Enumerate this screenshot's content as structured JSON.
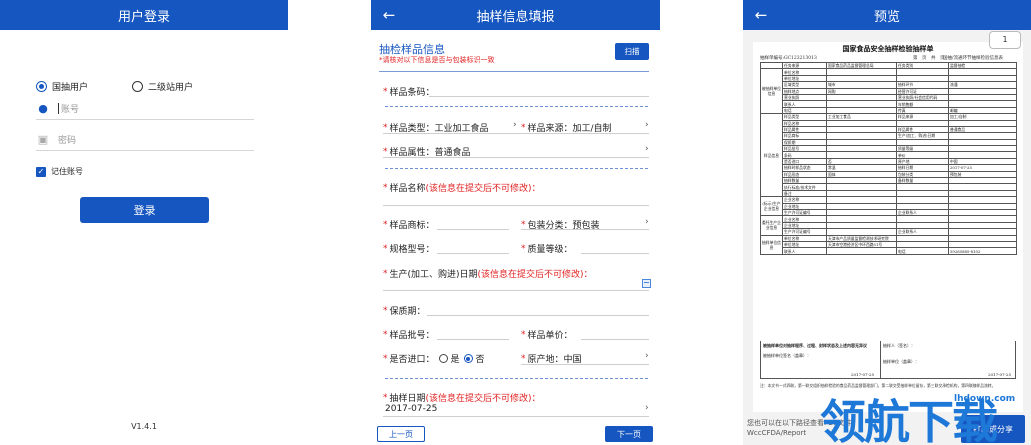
{
  "login": {
    "title": "用户登录",
    "radio_national": "国抽用户",
    "radio_secondary": "二级站用户",
    "account_placeholder": "账号",
    "password_placeholder": "密码",
    "remember": "记住账号",
    "login_button": "登录",
    "version": "V1.4.1"
  },
  "form": {
    "back_glyph": "←",
    "title": "抽样信息填报",
    "section_title": "抽检样品信息",
    "section_note": "*请核对以下信息是否与包装标识一致",
    "scan_button": "扫描",
    "fields": {
      "barcode": "样品条码：",
      "type_label": "样品类型：",
      "type_value": "工业加工食品",
      "source_label": "样品来源：",
      "source_value": "加工/自制",
      "attr_label": "样品属性：",
      "attr_value": "普通食品",
      "name_label": "样品名称",
      "name_note": "(该信息在提交后不可修改)：",
      "brand_label": "样品商标：",
      "pack_label": "包装分类：",
      "pack_value": "预包装",
      "spec_label": "规格型号：",
      "grade_label": "质量等级：",
      "date_label": "生产(加工、购进)日期",
      "date_note": "(该信息在提交后不可修改)：",
      "shelf_label": "保质期：",
      "batch_label": "样品批号：",
      "price_label": "样品单价：",
      "import_label": "是否进口：",
      "import_yes": "是",
      "import_no": "否",
      "origin_label": "原产地：",
      "origin_value": "中国",
      "sample_date_label": "抽样日期",
      "sample_date_note": "(该信息在提交后不可修改)：",
      "sample_date_value": "2017-07-25"
    },
    "prev_button": "上一页",
    "next_button": "下一页"
  },
  "preview": {
    "back_glyph": "←",
    "title": "预览",
    "page_badge": "1",
    "doc_title": "国家食品安全抽样检验抽样单",
    "doc_no": "抽样单编号:GC123213013",
    "doc_page": "第　页　共　页",
    "doc_org": "国抽/流通环节抽样检验信息表",
    "rows": [
      [
        "任务来源",
        "国家食品药品监督管理总局",
        "任务类别",
        "监督抽检"
      ],
      [
        "单位名称",
        "",
        "",
        ""
      ],
      [
        "单位地址",
        "",
        "",
        ""
      ],
      [
        "区域类型",
        "城市",
        "抽样环节",
        "流通"
      ],
      [
        "抽样地点",
        "网购",
        "经营许可证",
        ""
      ],
      [
        "营业执照",
        "",
        "营业执照/社会信用代码",
        ""
      ],
      [
        "联系人",
        "",
        "年销售额",
        ""
      ],
      [
        "电话",
        "",
        "传真",
        "邮编"
      ],
      [
        "样品类型",
        "工业加工食品",
        "样品来源",
        "加工/自制"
      ],
      [
        "样品名称",
        "",
        "",
        ""
      ],
      [
        "样品属性",
        "",
        "样品属性",
        "普通食品"
      ],
      [
        "样品商标",
        "",
        "生产(加工、购进)日期",
        ""
      ],
      [
        "保质期",
        "",
        "",
        ""
      ],
      [
        "样品批号",
        "",
        "质量等级",
        ""
      ],
      [
        "条码",
        "",
        "单价",
        ""
      ],
      [
        "是否进口",
        "否",
        "原产地",
        "中国"
      ],
      [
        "抽样时样品状态",
        "常温",
        "抽样日期",
        "2017-07-25"
      ],
      [
        "样品形态",
        "固体",
        "包装分类",
        "预包装"
      ],
      [
        "抽样数量",
        "",
        "备样数量",
        ""
      ],
      [
        "执行标准/技术文件",
        "",
        "",
        ""
      ],
      [
        "备注",
        "",
        "",
        ""
      ],
      [
        "企业名称",
        "",
        "",
        ""
      ],
      [
        "企业地址",
        "",
        "",
        ""
      ],
      [
        "生产许可证编号",
        "",
        "企业联系人",
        ""
      ],
      [
        "企业名称",
        "",
        "",
        ""
      ],
      [
        "企业地址",
        "",
        "",
        ""
      ],
      [
        "生产许可证编号",
        "",
        "企业联系人",
        ""
      ],
      [
        "单位名称",
        "天津市产品质量监督检测技术研究院",
        "",
        ""
      ],
      [
        "单位地址",
        "天津市空港经济区中环西路51号",
        "",
        ""
      ],
      [
        "联系人",
        "",
        "电话",
        "59265885-8102"
      ]
    ],
    "groups": [
      "被抽样单位信息",
      "样品信息",
      "(标示)生产企业信息",
      "委托生产企业信息",
      "抽样单位信息"
    ],
    "sig_left": "被抽样单位对抽样程序、过程、封样状态及上述内容无异议",
    "sig_left2": "被抽样单位签名（盖章）：",
    "sig_right": "抽样人（签名）：",
    "sig_right2": "抽样单位（盖章）：",
    "sig_date": "2017-07-25",
    "doc_foot": "注：本文书一式四联，第一联交组织抽样检验的食品药品监督管理部门，第二联交受抽样单位留存，第三联交承检机构，第四联随样品流转。",
    "pdf_note_1": "您也可以在以下路径查看PDF文件：",
    "pdf_note_2": "WccCFDA/Report",
    "print_button": "打印或分享"
  },
  "watermark": {
    "text": "领航下载",
    "url": "lhdown.com"
  },
  "colors": {
    "primary": "#1656c0",
    "required": "#e02020",
    "watermark": "#1e78d8"
  }
}
